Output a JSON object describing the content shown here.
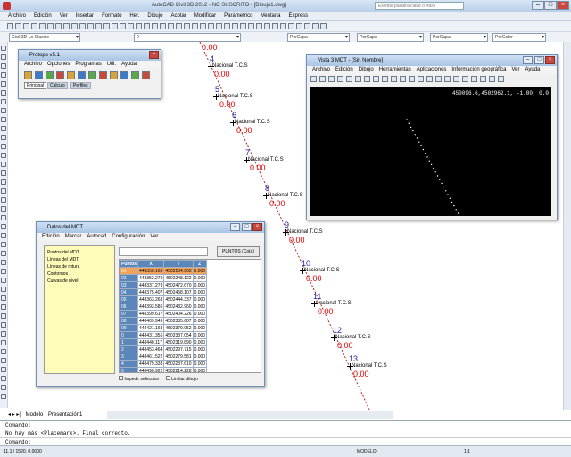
{
  "app": {
    "title": "AutoCAD Civil 3D 2012 - NO SUSCRITO - [Dibujo1.dwg]",
    "search_placeholder": "Escriba palabra clave o frase"
  },
  "menu": [
    "Archivo",
    "Edición",
    "Ver",
    "Insertar",
    "Formato",
    "Her.",
    "Dibujo",
    "Acotar",
    "Modificar",
    "Parametrico",
    "Ventana",
    "Express"
  ],
  "toolbar": {
    "workspace": "Civil 3D Lo Clasico",
    "layer": "0",
    "color": "PorCapa",
    "linetype": "PorCapa",
    "lineweight": "PorCapa",
    "plotstyle": "PorColor",
    "layer_state": "Actual",
    "textstyle": "Standard",
    "dimstyle": "ISO-25"
  },
  "protopo": {
    "title": "Protopo v5.1",
    "menu": [
      "Archivo",
      "Opciones",
      "Programas",
      "Util.",
      "Ayuda"
    ],
    "tabs": [
      "Principal",
      "Calculo",
      "Perfiles"
    ]
  },
  "mdt": {
    "title": "Vista 3 MDT - [Sin Nombre]",
    "menu": [
      "Archivo",
      "Edición",
      "Dibujo",
      "Herramientas",
      "Aplicaciones",
      "Información geográfica",
      "Ver",
      "Ayuda"
    ],
    "coords": "450096.6,4502962.1, -1.00, 0.0"
  },
  "datos": {
    "title": "Datos del MDT",
    "menu": [
      "Edición",
      "Marcar",
      "Autocad",
      "Configuración",
      "Ver"
    ],
    "search_value": "",
    "points_button": "PUNTOS (Cota)",
    "tree": [
      "Puntos del MDT",
      "Líneas del MDT",
      "Líneas de rotura",
      "Contornos",
      "Curvas de nivel"
    ],
    "columns": [
      "Puntos",
      "X",
      "Y",
      "Z"
    ],
    "rows": [
      [
        "01",
        "448350.166",
        "4502234.063",
        "0.000"
      ],
      [
        "02",
        "448352.279",
        "4502248.122",
        "0.000"
      ],
      [
        "03",
        "448337.279",
        "4502472.670",
        "0.000"
      ],
      [
        "04",
        "448375.407",
        "4502458.107",
        "0.000"
      ],
      [
        "05",
        "448363.263",
        "4502444.337",
        "0.000"
      ],
      [
        "06",
        "448393.586",
        "4502432.960",
        "0.000"
      ],
      [
        "07",
        "448399.617",
        "4502404.226",
        "0.000"
      ],
      [
        "08",
        "448409.949",
        "4502385.687",
        "0.000"
      ],
      [
        "09",
        "448421.168",
        "4502370.052",
        "0.000"
      ],
      [
        "0",
        "448431.355",
        "4502337.054",
        "0.000"
      ],
      [
        "1",
        "448440.117",
        "4502319.890",
        "0.000"
      ],
      [
        "2",
        "448453.464",
        "4502297.715",
        "0.000"
      ],
      [
        "3",
        "448461.522",
        "4502279.581",
        "0.000"
      ],
      [
        "4",
        "448479.338",
        "4502237.610",
        "0.000"
      ],
      [
        "5",
        "448490.922",
        "4502214.228",
        "0.000"
      ]
    ],
    "check1": "Impedir seleccion",
    "check2": "Limitar dibujo",
    "footer": "PUNTOS (Cota)"
  },
  "drawing_labels": [
    {
      "n": "4",
      "t": "Nacional T.C.S",
      "z": "0.00"
    },
    {
      "n": "5",
      "t": "Nacional T.C.S",
      "z": "0.00"
    },
    {
      "n": "6",
      "t": "Nacional T.C.S",
      "z": "0.00"
    },
    {
      "n": "7",
      "t": "Nacional T.C.S",
      "z": "0.00"
    },
    {
      "n": "8",
      "t": "Nacional T.C.S",
      "z": "0.00"
    },
    {
      "n": "9",
      "t": "Nacional T.C.S",
      "z": "0.00"
    },
    {
      "n": "10",
      "t": "Nacional T.C.S",
      "z": "0.00"
    },
    {
      "n": "11",
      "t": "Nacional T.C.S",
      "z": "0.00"
    },
    {
      "n": "12",
      "t": "Nacional T.C.S",
      "z": "0.00"
    },
    {
      "n": "13",
      "t": "Nacional T.C.S",
      "z": "0.00"
    }
  ],
  "top_zero": "0.00",
  "tabs": [
    "Modelo",
    "Presentación1"
  ],
  "command": {
    "line1": "Comando:",
    "line2": "No hay más <Placemark>. Final correcto.",
    "prompt": "Comando:"
  },
  "status": {
    "coords": "11.1 / 1520, 0.0000",
    "model": "MODELO",
    "scale": "1:1"
  }
}
